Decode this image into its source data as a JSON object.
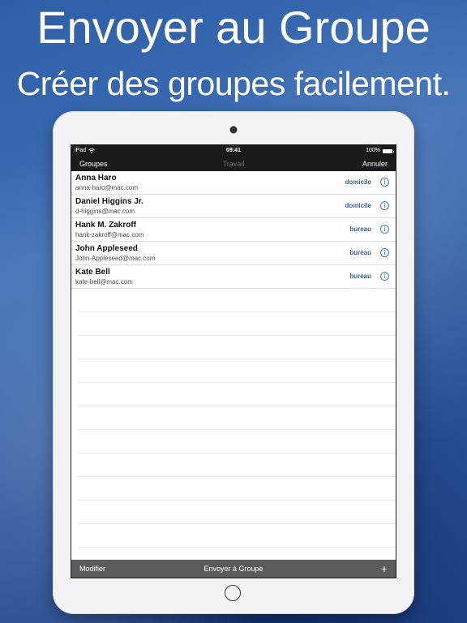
{
  "headline": "Envoyer au Groupe",
  "subline": "Créer des groupes facilement.",
  "status_bar": {
    "carrier": "iPad",
    "time": "09:41",
    "battery": "100%"
  },
  "nav_bar": {
    "left": "Groupes",
    "title": "Travail",
    "right": "Annuler"
  },
  "contacts": [
    {
      "name": "Anna Haro",
      "email": "anna-haro@mac.com",
      "label": "domicile"
    },
    {
      "name": "Daniel Higgins Jr.",
      "email": "d-higgins@mac.com",
      "label": "domicile"
    },
    {
      "name": "Hank M. Zakroff",
      "email": "hank-zakroff@mac.com",
      "label": "bureau"
    },
    {
      "name": "John Appleseed",
      "email": "John-Appleseed@mac.com",
      "label": "bureau"
    },
    {
      "name": "Kate Bell",
      "email": "kate-bell@mac.com",
      "label": "bureau"
    }
  ],
  "toolbar": {
    "left": "Modifier",
    "center": "Envoyer à Groupe",
    "right": "+"
  },
  "icons": {
    "info": "info-icon",
    "wifi": "wifi-icon",
    "battery": "battery-icon",
    "add": "plus-icon"
  },
  "colors": {
    "background": "#2e5ea6",
    "bar": "#1b1b1b",
    "toolbar": "#5a5a5a",
    "accent": "#3d7fd6",
    "label": "#3a5f8c"
  }
}
